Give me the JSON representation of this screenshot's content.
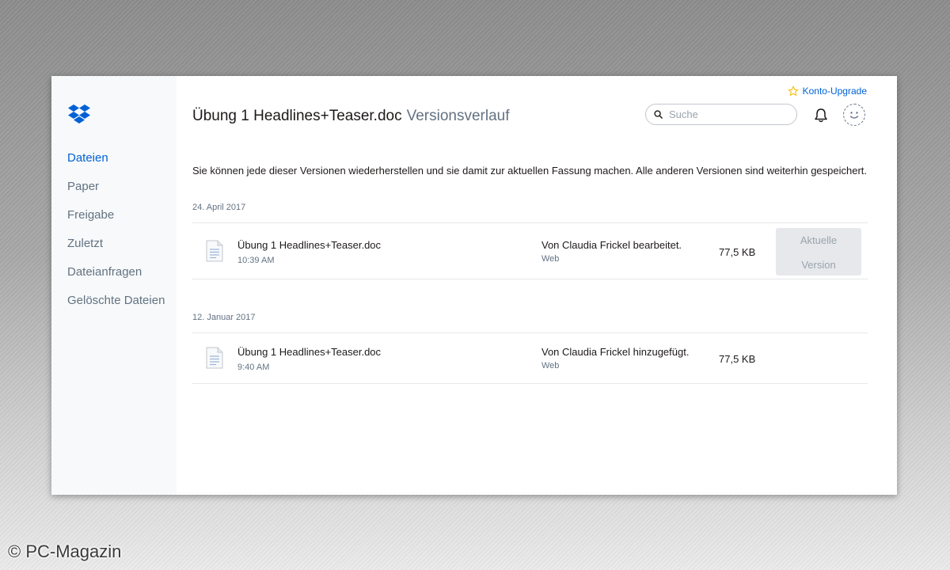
{
  "sidebar": {
    "items": [
      {
        "label": "Dateien"
      },
      {
        "label": "Paper"
      },
      {
        "label": "Freigabe"
      },
      {
        "label": "Zuletzt"
      },
      {
        "label": "Dateianfragen"
      },
      {
        "label": "Gelöschte Dateien"
      }
    ],
    "active_index": 0
  },
  "header": {
    "upgrade_label": "Konto-Upgrade",
    "file_name": "Übung 1 Headlines+Teaser.doc",
    "subtitle": "Versionsverlauf",
    "search_placeholder": "Suche"
  },
  "info_text": "Sie können jede dieser Versionen wiederherstellen und sie damit zur aktuellen Fassung machen. Alle anderen Versionen sind weiterhin gespeichert.",
  "versions": [
    {
      "date": "24. April 2017",
      "file_name": "Übung 1 Headlines+Teaser.doc",
      "time": "10:39 AM",
      "action": "Von Claudia Frickel bearbeitet.",
      "source": "Web",
      "size": "77,5 KB",
      "current_line1": "Aktuelle",
      "current_line2": "Version"
    },
    {
      "date": "12. Januar 2017",
      "file_name": "Übung 1 Headlines+Teaser.doc",
      "time": "9:40 AM",
      "action": "Von Claudia Frickel hinzugefügt.",
      "source": "Web",
      "size": "77,5 KB"
    }
  ],
  "watermark": "© PC-Magazin",
  "colors": {
    "accent": "#0061d6",
    "text": "#1e1919",
    "muted": "#637282",
    "sidebar_bg": "#f7f9fa",
    "divider": "#e6e8eb",
    "upgrade_star": "#f7c325"
  },
  "icons": {
    "logo": "dropbox-logo",
    "upgrade": "star-icon",
    "search": "search-icon",
    "notifications": "bell-icon",
    "avatar": "avatar-placeholder",
    "file": "document-icon"
  }
}
